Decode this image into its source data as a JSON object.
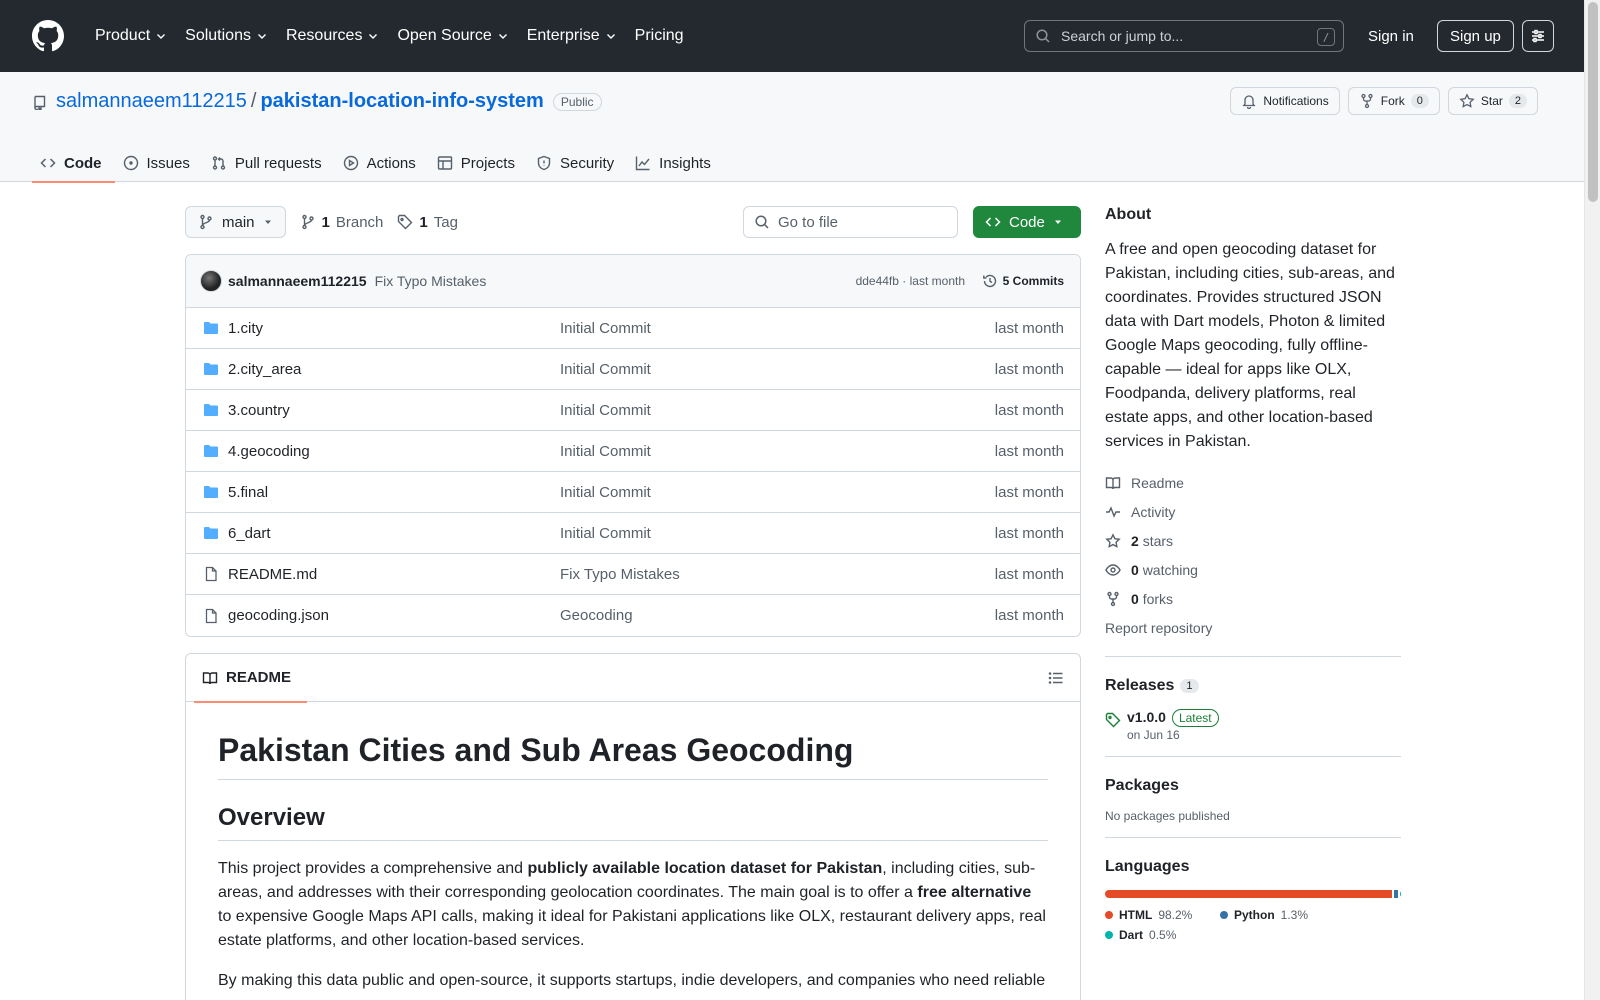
{
  "header": {
    "nav": [
      {
        "label": "Product",
        "dropdown": true
      },
      {
        "label": "Solutions",
        "dropdown": true
      },
      {
        "label": "Resources",
        "dropdown": true
      },
      {
        "label": "Open Source",
        "dropdown": true
      },
      {
        "label": "Enterprise",
        "dropdown": true
      },
      {
        "label": "Pricing",
        "dropdown": false
      }
    ],
    "search_placeholder": "Search or jump to...",
    "search_shortcut": "/",
    "signin": "Sign in",
    "signup": "Sign up"
  },
  "repo": {
    "owner": "salmannaeem112215",
    "separator": "/",
    "name": "pakistan-location-info-system",
    "visibility": "Public",
    "notifications": "Notifications",
    "fork_label": "Fork",
    "fork_count": "0",
    "star_label": "Star",
    "star_count": "2",
    "tabs": [
      {
        "label": "Code",
        "icon": "code-icon"
      },
      {
        "label": "Issues",
        "icon": "issue-icon"
      },
      {
        "label": "Pull requests",
        "icon": "pull-request-icon"
      },
      {
        "label": "Actions",
        "icon": "play-icon"
      },
      {
        "label": "Projects",
        "icon": "table-icon"
      },
      {
        "label": "Security",
        "icon": "shield-icon"
      },
      {
        "label": "Insights",
        "icon": "graph-icon"
      }
    ]
  },
  "toolbar": {
    "branch": "main",
    "branch_count": "1",
    "branch_label": "Branch",
    "tag_count": "1",
    "tag_label": "Tag",
    "goto_placeholder": "Go to file",
    "code_button": "Code"
  },
  "commit": {
    "author": "salmannaeem112215",
    "message": "Fix Typo Mistakes",
    "hash": "dde44fb",
    "dot": "·",
    "time": "last month",
    "count_label": "5 Commits"
  },
  "files": [
    {
      "name": "1.city",
      "type": "folder",
      "message": "Initial Commit",
      "date": "last month"
    },
    {
      "name": "2.city_area",
      "type": "folder",
      "message": "Initial Commit",
      "date": "last month"
    },
    {
      "name": "3.country",
      "type": "folder",
      "message": "Initial Commit",
      "date": "last month"
    },
    {
      "name": "4.geocoding",
      "type": "folder",
      "message": "Initial Commit",
      "date": "last month"
    },
    {
      "name": "5.final",
      "type": "folder",
      "message": "Initial Commit",
      "date": "last month"
    },
    {
      "name": "6_dart",
      "type": "folder",
      "message": "Initial Commit",
      "date": "last month"
    },
    {
      "name": "README.md",
      "type": "file",
      "message": "Fix Typo Mistakes",
      "date": "last month"
    },
    {
      "name": "geocoding.json",
      "type": "file",
      "message": "Geocoding",
      "date": "last month"
    }
  ],
  "readme": {
    "tab": "README",
    "h1": "Pakistan Cities and Sub Areas Geocoding",
    "h2": "Overview",
    "p1_a": "This project provides a comprehensive and ",
    "p1_b": "publicly available location dataset for Pakistan",
    "p1_c": ", including cities, sub-areas, and addresses with their corresponding geolocation coordinates. The main goal is to offer a ",
    "p1_d": "free alternative",
    "p1_e": " to expensive Google Maps API calls, making it ideal for Pakistani applications like OLX, restaurant delivery apps, real estate platforms, and other location-based services.",
    "p2": "By making this data public and open-source, it supports startups, indie developers, and companies who need reliable"
  },
  "about": {
    "title": "About",
    "description": "A free and open geocoding dataset for Pakistan, including cities, sub-areas, and coordinates. Provides structured JSON data with Dart models, Photon & limited Google Maps geocoding, fully offline-capable — ideal for apps like OLX, Foodpanda, delivery platforms, real estate apps, and other location-based services in Pakistan.",
    "readme": "Readme",
    "activity": "Activity",
    "stars_count": "2",
    "stars_label": "stars",
    "watching_count": "0",
    "watching_label": "watching",
    "forks_count": "0",
    "forks_label": "forks",
    "report": "Report repository"
  },
  "releases": {
    "title": "Releases",
    "count": "1",
    "tag": "v1.0.0",
    "badge": "Latest",
    "date": "on Jun 16"
  },
  "packages": {
    "title": "Packages",
    "empty": "No packages published"
  },
  "languages": {
    "title": "Languages",
    "items": [
      {
        "name": "HTML",
        "percent": "98.2%",
        "value": 98.2,
        "color": "#e34c26"
      },
      {
        "name": "Python",
        "percent": "1.3%",
        "value": 1.3,
        "color": "#3572A5"
      },
      {
        "name": "Dart",
        "percent": "0.5%",
        "value": 0.5,
        "color": "#00B4AB"
      }
    ]
  },
  "colors": {
    "header_bg": "#24292f",
    "link": "#0969da",
    "primary_button": "#1f883d",
    "tab_underline": "#fd8c73"
  }
}
